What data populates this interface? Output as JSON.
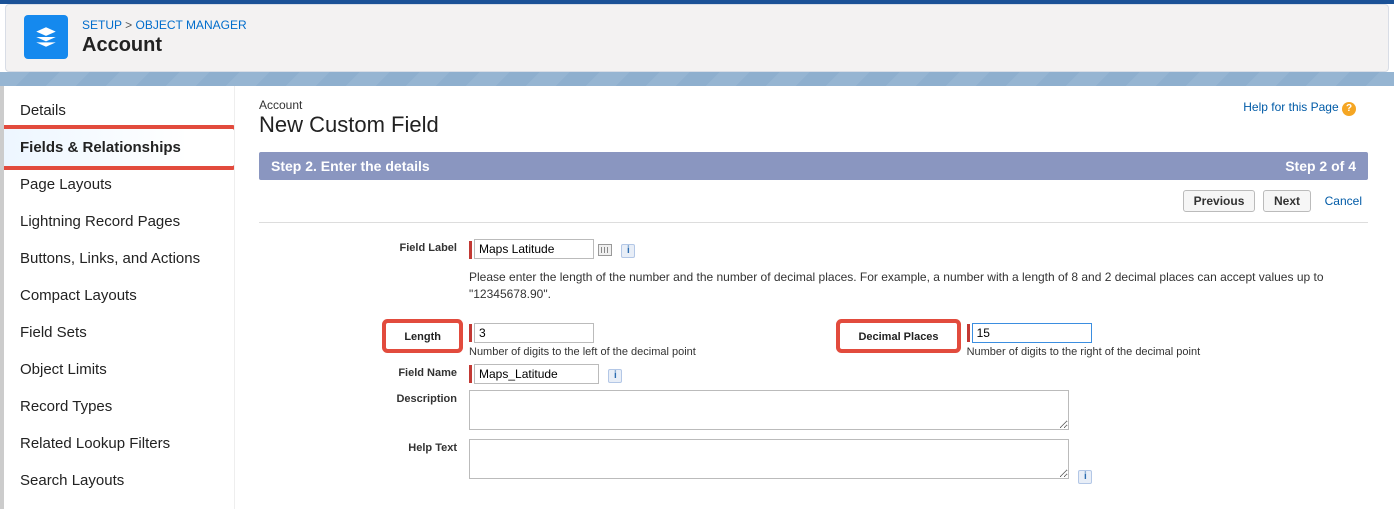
{
  "breadcrumb": {
    "setup": "SETUP",
    "objmgr": "OBJECT MANAGER"
  },
  "object_title": "Account",
  "sidebar": {
    "items": [
      {
        "label": "Details"
      },
      {
        "label": "Fields & Relationships"
      },
      {
        "label": "Page Layouts"
      },
      {
        "label": "Lightning Record Pages"
      },
      {
        "label": "Buttons, Links, and Actions"
      },
      {
        "label": "Compact Layouts"
      },
      {
        "label": "Field Sets"
      },
      {
        "label": "Object Limits"
      },
      {
        "label": "Record Types"
      },
      {
        "label": "Related Lookup Filters"
      },
      {
        "label": "Search Layouts"
      }
    ]
  },
  "page": {
    "sub": "Account",
    "title": "New Custom Field",
    "help": "Help for this Page"
  },
  "step": {
    "left": "Step 2. Enter the details",
    "right": "Step 2 of 4"
  },
  "buttons": {
    "prev": "Previous",
    "next": "Next",
    "cancel": "Cancel"
  },
  "form": {
    "field_label_lbl": "Field Label",
    "field_label_val": "Maps Latitude",
    "note": "Please enter the length of the number and the number of decimal places. For example, a number with a length of 8 and 2 decimal places can accept values up to \"12345678.90\".",
    "length_lbl": "Length",
    "length_val": "3",
    "length_hint": "Number of digits to the left of the decimal point",
    "dec_lbl": "Decimal Places",
    "dec_val": "15",
    "dec_hint": "Number of digits to the right of the decimal point",
    "field_name_lbl": "Field Name",
    "field_name_val": "Maps_Latitude",
    "desc_lbl": "Description",
    "desc_val": "",
    "helptext_lbl": "Help Text",
    "helptext_val": ""
  }
}
